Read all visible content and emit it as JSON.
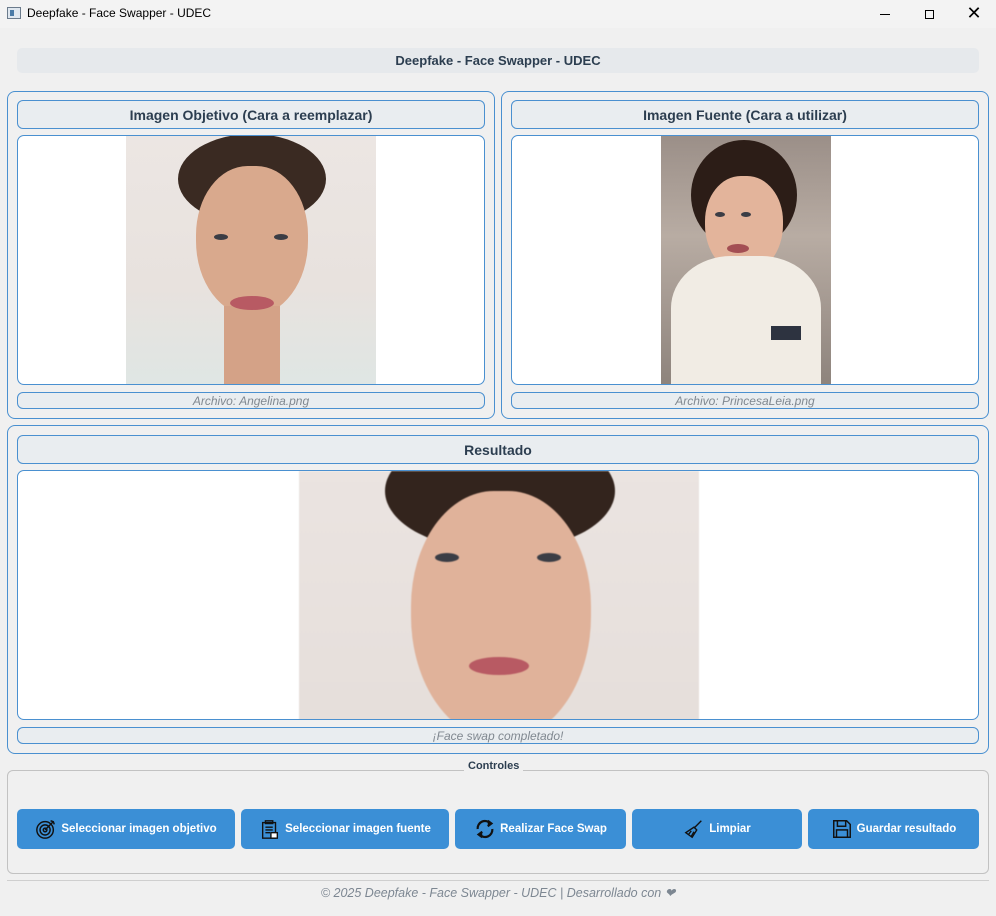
{
  "window": {
    "title": "Deepfake - Face Swapper - UDEC"
  },
  "header": {
    "title": "Deepfake - Face Swapper - UDEC"
  },
  "target_panel": {
    "title": "Imagen Objetivo (Cara a reemplazar)",
    "file_label": "Archivo: Angelina.png"
  },
  "source_panel": {
    "title": "Imagen Fuente (Cara a utilizar)",
    "file_label": "Archivo: PrincesaLeia.png"
  },
  "result_panel": {
    "title": "Resultado",
    "status": "¡Face swap completado!"
  },
  "controls": {
    "legend": "Controles",
    "buttons": [
      {
        "label": "Seleccionar imagen objetivo",
        "icon": "target-icon"
      },
      {
        "label": "Seleccionar imagen fuente",
        "icon": "document-icon"
      },
      {
        "label": "Realizar Face Swap",
        "icon": "refresh-icon"
      },
      {
        "label": "Limpiar",
        "icon": "broom-icon"
      },
      {
        "label": "Guardar resultado",
        "icon": "save-icon"
      }
    ]
  },
  "footer": {
    "text": "© 2025 Deepfake - Face Swapper - UDEC | Desarrollado con ❤"
  },
  "colors": {
    "accent": "#3b8fd6",
    "panel_border": "#4a90d0",
    "background": "#f0f0f0"
  }
}
